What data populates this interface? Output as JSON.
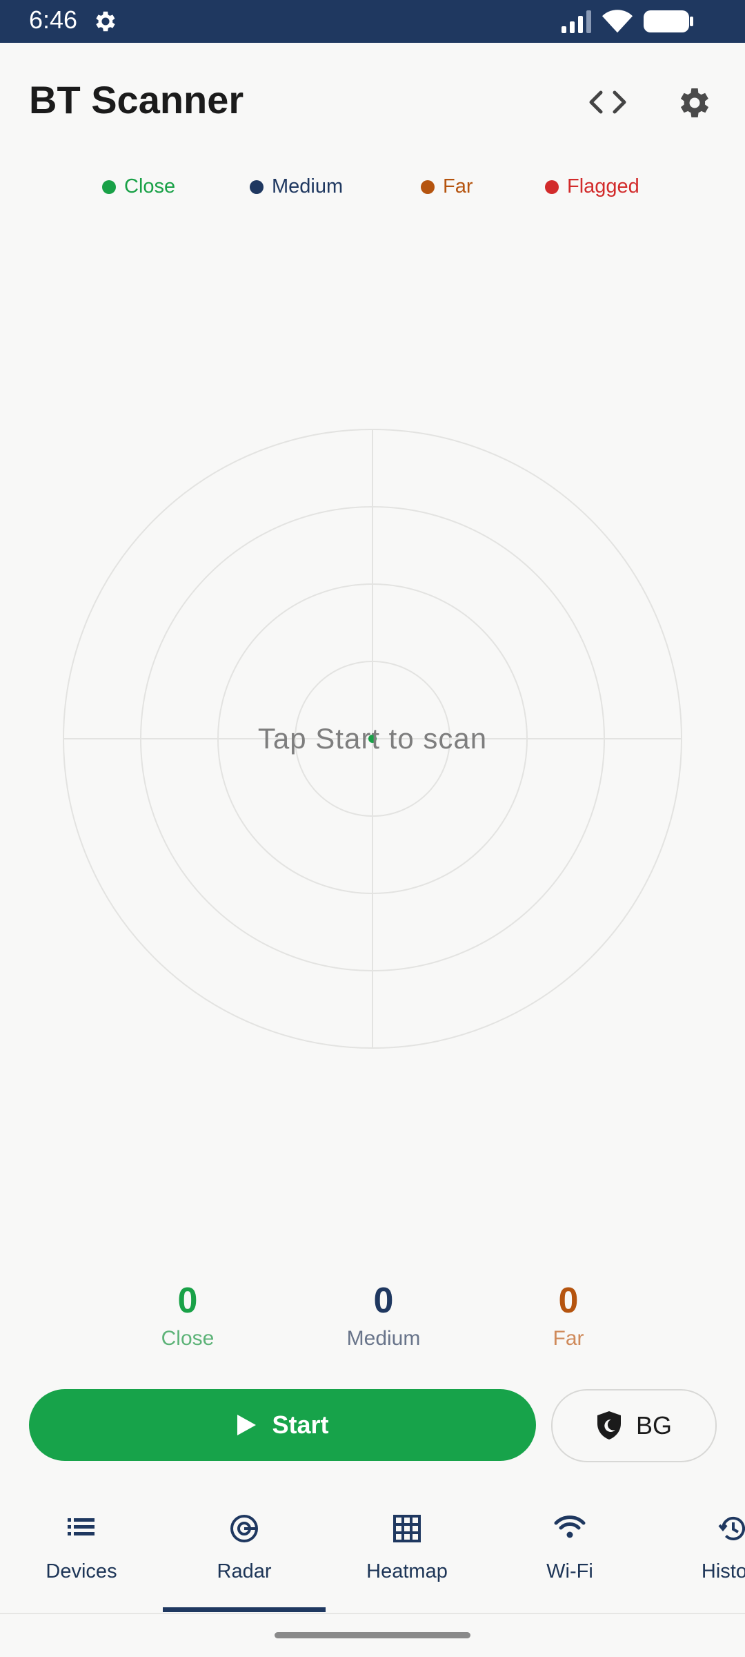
{
  "status_bar": {
    "time": "6:46"
  },
  "app_bar": {
    "title": "BT Scanner"
  },
  "legend": [
    {
      "label": "Close",
      "color": "#19a147"
    },
    {
      "label": "Medium",
      "color": "#1f3860"
    },
    {
      "label": "Far",
      "color": "#b5540f"
    },
    {
      "label": "Flagged",
      "color": "#d22b2b"
    }
  ],
  "radar": {
    "message": "Tap Start to scan"
  },
  "counters": [
    {
      "value": "0",
      "label": "Close",
      "color": "#19a147",
      "label_color": "#5db378"
    },
    {
      "value": "0",
      "label": "Medium",
      "color": "#1f3860",
      "label_color": "#68748a"
    },
    {
      "value": "0",
      "label": "Far",
      "color": "#b5540f",
      "label_color": "#cf8a5a"
    }
  ],
  "actions": {
    "start_label": "Start",
    "bg_label": "BG"
  },
  "nav": [
    {
      "label": "Devices",
      "icon": "list-icon"
    },
    {
      "label": "Radar",
      "icon": "radar-icon",
      "active": true
    },
    {
      "label": "Heatmap",
      "icon": "grid-icon"
    },
    {
      "label": "Wi-Fi",
      "icon": "wifi-icon"
    },
    {
      "label": "History",
      "icon": "history-icon"
    }
  ]
}
